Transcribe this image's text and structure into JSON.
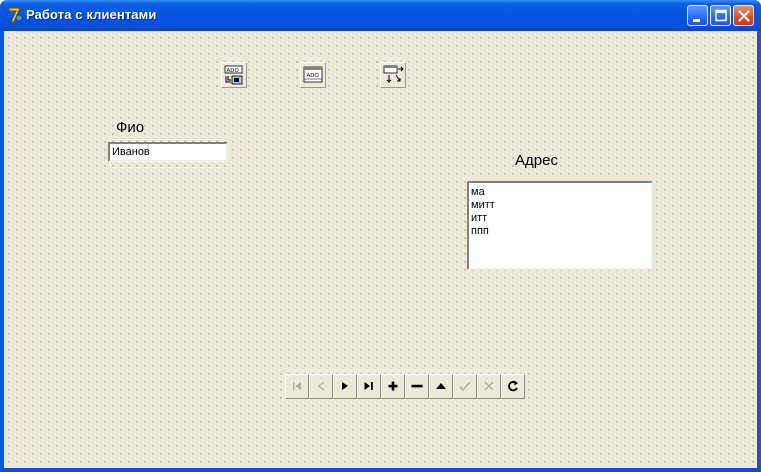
{
  "window": {
    "title": "Работа с клиентами"
  },
  "form": {
    "fio_label": "Фио",
    "fio_value": "Иванов",
    "address_label": "Адрес",
    "address_items": [
      "ма",
      "митт",
      "итт",
      "ппп"
    ]
  },
  "components": [
    {
      "icon": "ado-connection-icon",
      "text": "ADO"
    },
    {
      "icon": "ado-table-icon",
      "text": "ADO"
    },
    {
      "icon": "datasource-icon",
      "text": ""
    }
  ],
  "navigator": {
    "buttons": [
      {
        "icon": "first-record-icon",
        "enabled": false
      },
      {
        "icon": "prior-record-icon",
        "enabled": false
      },
      {
        "icon": "next-record-icon",
        "enabled": true
      },
      {
        "icon": "last-record-icon",
        "enabled": true
      },
      {
        "icon": "insert-record-icon",
        "enabled": true
      },
      {
        "icon": "delete-record-icon",
        "enabled": true
      },
      {
        "icon": "edit-record-icon",
        "enabled": true
      },
      {
        "icon": "post-record-icon",
        "enabled": false
      },
      {
        "icon": "cancel-record-icon",
        "enabled": false
      },
      {
        "icon": "refresh-icon",
        "enabled": true
      }
    ]
  },
  "colors": {
    "titlebar": "#0554e0",
    "client_bg": "#ece9d8",
    "close_button": "#d9532e"
  }
}
